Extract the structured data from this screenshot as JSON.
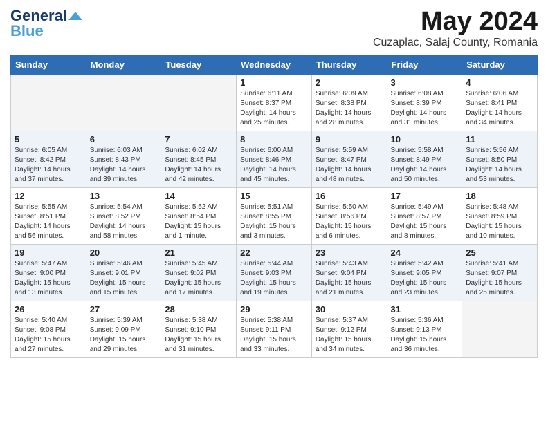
{
  "header": {
    "logo_line1": "General",
    "logo_line2": "Blue",
    "month_title": "May 2024",
    "subtitle": "Cuzaplac, Salaj County, Romania"
  },
  "weekdays": [
    "Sunday",
    "Monday",
    "Tuesday",
    "Wednesday",
    "Thursday",
    "Friday",
    "Saturday"
  ],
  "weeks": [
    [
      {
        "day": "",
        "empty": true
      },
      {
        "day": "",
        "empty": true
      },
      {
        "day": "",
        "empty": true
      },
      {
        "day": "1",
        "sunrise": "6:11 AM",
        "sunset": "8:37 PM",
        "daylight": "14 hours and 25 minutes."
      },
      {
        "day": "2",
        "sunrise": "6:09 AM",
        "sunset": "8:38 PM",
        "daylight": "14 hours and 28 minutes."
      },
      {
        "day": "3",
        "sunrise": "6:08 AM",
        "sunset": "8:39 PM",
        "daylight": "14 hours and 31 minutes."
      },
      {
        "day": "4",
        "sunrise": "6:06 AM",
        "sunset": "8:41 PM",
        "daylight": "14 hours and 34 minutes."
      }
    ],
    [
      {
        "day": "5",
        "sunrise": "6:05 AM",
        "sunset": "8:42 PM",
        "daylight": "14 hours and 37 minutes."
      },
      {
        "day": "6",
        "sunrise": "6:03 AM",
        "sunset": "8:43 PM",
        "daylight": "14 hours and 39 minutes."
      },
      {
        "day": "7",
        "sunrise": "6:02 AM",
        "sunset": "8:45 PM",
        "daylight": "14 hours and 42 minutes."
      },
      {
        "day": "8",
        "sunrise": "6:00 AM",
        "sunset": "8:46 PM",
        "daylight": "14 hours and 45 minutes."
      },
      {
        "day": "9",
        "sunrise": "5:59 AM",
        "sunset": "8:47 PM",
        "daylight": "14 hours and 48 minutes."
      },
      {
        "day": "10",
        "sunrise": "5:58 AM",
        "sunset": "8:49 PM",
        "daylight": "14 hours and 50 minutes."
      },
      {
        "day": "11",
        "sunrise": "5:56 AM",
        "sunset": "8:50 PM",
        "daylight": "14 hours and 53 minutes."
      }
    ],
    [
      {
        "day": "12",
        "sunrise": "5:55 AM",
        "sunset": "8:51 PM",
        "daylight": "14 hours and 56 minutes."
      },
      {
        "day": "13",
        "sunrise": "5:54 AM",
        "sunset": "8:52 PM",
        "daylight": "14 hours and 58 minutes."
      },
      {
        "day": "14",
        "sunrise": "5:52 AM",
        "sunset": "8:54 PM",
        "daylight": "15 hours and 1 minute."
      },
      {
        "day": "15",
        "sunrise": "5:51 AM",
        "sunset": "8:55 PM",
        "daylight": "15 hours and 3 minutes."
      },
      {
        "day": "16",
        "sunrise": "5:50 AM",
        "sunset": "8:56 PM",
        "daylight": "15 hours and 6 minutes."
      },
      {
        "day": "17",
        "sunrise": "5:49 AM",
        "sunset": "8:57 PM",
        "daylight": "15 hours and 8 minutes."
      },
      {
        "day": "18",
        "sunrise": "5:48 AM",
        "sunset": "8:59 PM",
        "daylight": "15 hours and 10 minutes."
      }
    ],
    [
      {
        "day": "19",
        "sunrise": "5:47 AM",
        "sunset": "9:00 PM",
        "daylight": "15 hours and 13 minutes."
      },
      {
        "day": "20",
        "sunrise": "5:46 AM",
        "sunset": "9:01 PM",
        "daylight": "15 hours and 15 minutes."
      },
      {
        "day": "21",
        "sunrise": "5:45 AM",
        "sunset": "9:02 PM",
        "daylight": "15 hours and 17 minutes."
      },
      {
        "day": "22",
        "sunrise": "5:44 AM",
        "sunset": "9:03 PM",
        "daylight": "15 hours and 19 minutes."
      },
      {
        "day": "23",
        "sunrise": "5:43 AM",
        "sunset": "9:04 PM",
        "daylight": "15 hours and 21 minutes."
      },
      {
        "day": "24",
        "sunrise": "5:42 AM",
        "sunset": "9:05 PM",
        "daylight": "15 hours and 23 minutes."
      },
      {
        "day": "25",
        "sunrise": "5:41 AM",
        "sunset": "9:07 PM",
        "daylight": "15 hours and 25 minutes."
      }
    ],
    [
      {
        "day": "26",
        "sunrise": "5:40 AM",
        "sunset": "9:08 PM",
        "daylight": "15 hours and 27 minutes."
      },
      {
        "day": "27",
        "sunrise": "5:39 AM",
        "sunset": "9:09 PM",
        "daylight": "15 hours and 29 minutes."
      },
      {
        "day": "28",
        "sunrise": "5:38 AM",
        "sunset": "9:10 PM",
        "daylight": "15 hours and 31 minutes."
      },
      {
        "day": "29",
        "sunrise": "5:38 AM",
        "sunset": "9:11 PM",
        "daylight": "15 hours and 33 minutes."
      },
      {
        "day": "30",
        "sunrise": "5:37 AM",
        "sunset": "9:12 PM",
        "daylight": "15 hours and 34 minutes."
      },
      {
        "day": "31",
        "sunrise": "5:36 AM",
        "sunset": "9:13 PM",
        "daylight": "15 hours and 36 minutes."
      },
      {
        "day": "",
        "empty": true
      }
    ]
  ]
}
